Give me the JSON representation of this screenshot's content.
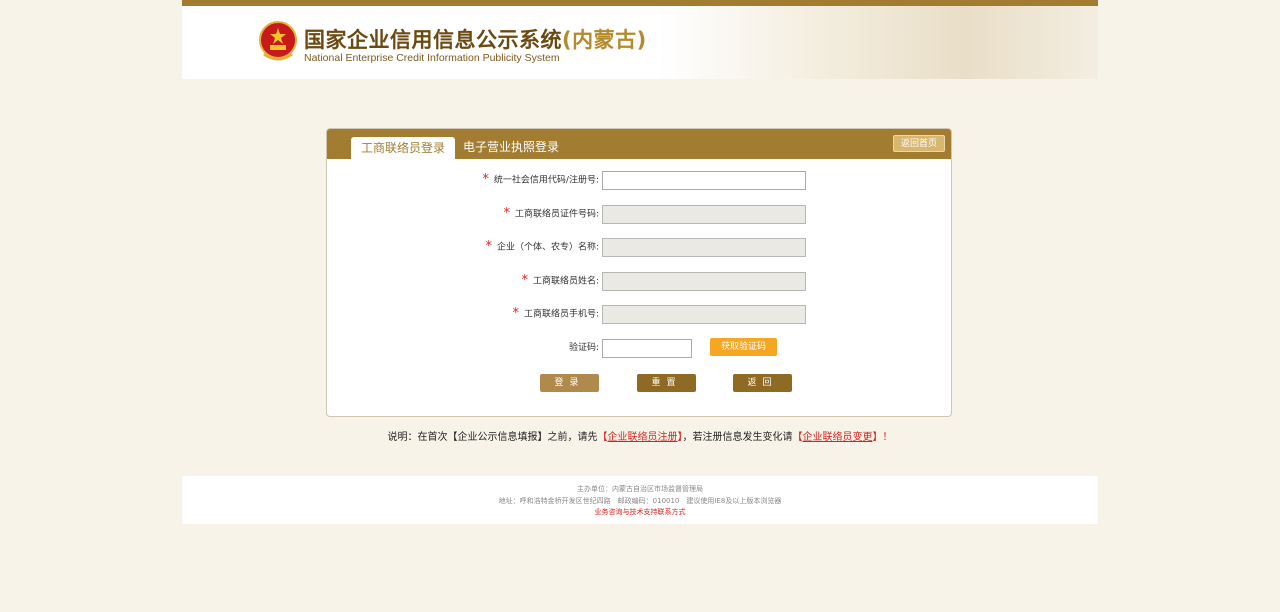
{
  "header": {
    "title_cn": "国家企业信用信息公示系统",
    "title_region": "(内蒙古)",
    "title_en": "National Enterprise Credit Information Publicity System"
  },
  "panel": {
    "tab_active": "工商联络员登录",
    "tab_inactive": "电子营业执照登录",
    "home_button": "返回首页"
  },
  "form": {
    "fields": [
      {
        "label": "统一社会信用代码/注册号:",
        "value": "",
        "required": true,
        "disabled": false
      },
      {
        "label": "工商联络员证件号码:",
        "value": "",
        "required": true,
        "disabled": true
      },
      {
        "label": "企业（个体、农专）名称:",
        "value": "",
        "required": true,
        "disabled": true
      },
      {
        "label": "工商联络员姓名:",
        "value": "",
        "required": true,
        "disabled": true
      },
      {
        "label": "工商联络员手机号:",
        "value": "",
        "required": true,
        "disabled": true
      }
    ],
    "captcha_label": "验证码:",
    "captcha_value": "",
    "get_code_button": "获取验证码",
    "required_mark": "*",
    "login_button": "登录",
    "reset_button": "重置",
    "back_button": "返回"
  },
  "note": {
    "prefix": "说明：在首次【企业公示信息填报】之前，请先",
    "link1_open": "【",
    "link1": "企业联络员注册",
    "link1_close": "】",
    "middle": "，若注册信息发生变化请",
    "link2_open": "【",
    "link2": "企业联络员变更",
    "link2_close": "】！"
  },
  "footer": {
    "line1": "主办单位：内蒙古自治区市场监督管理局",
    "line2": "地址：呼和浩特金桥开发区世纪四路　邮政编码：010010　建议使用IE8及以上版本浏览器",
    "line3": "业务咨询与技术支持联系方式"
  },
  "colors": {
    "brand": "#a27c30",
    "accent_orange": "#f5a623",
    "required_red": "#d9221c",
    "page_bg": "#f7f3e9"
  }
}
